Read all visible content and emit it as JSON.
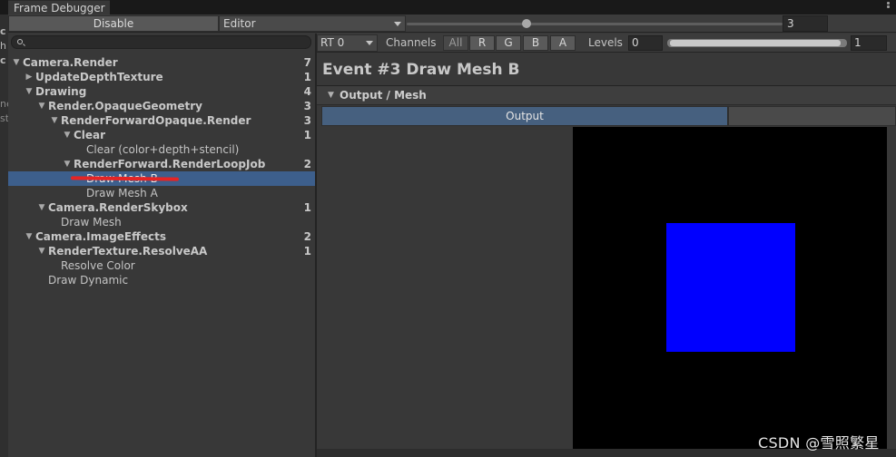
{
  "window": {
    "tab_title": "Frame Debugger"
  },
  "ghost_strip": [
    "c",
    "h",
    "c",
    "ne",
    "st"
  ],
  "toolbar": {
    "disable_label": "Disable",
    "target_dropdown": "Editor",
    "event_slider": {
      "value": 3,
      "max": 7,
      "fraction": 0.32
    },
    "event_index": "3"
  },
  "tree": {
    "search_placeholder": "",
    "items": [
      {
        "label": "Camera.Render",
        "count": "7",
        "depth": 0,
        "expand": "open",
        "bold": true
      },
      {
        "label": "UpdateDepthTexture",
        "count": "1",
        "depth": 1,
        "expand": "closed",
        "bold": true
      },
      {
        "label": "Drawing",
        "count": "4",
        "depth": 1,
        "expand": "open",
        "bold": true
      },
      {
        "label": "Render.OpaqueGeometry",
        "count": "3",
        "depth": 2,
        "expand": "open",
        "bold": true
      },
      {
        "label": "RenderForwardOpaque.Render",
        "count": "3",
        "depth": 3,
        "expand": "open",
        "bold": true
      },
      {
        "label": "Clear",
        "count": "1",
        "depth": 4,
        "expand": "open",
        "bold": true
      },
      {
        "label": "Clear (color+depth+stencil)",
        "count": "",
        "depth": 5,
        "expand": "none",
        "bold": false
      },
      {
        "label": "RenderForward.RenderLoopJob",
        "count": "2",
        "depth": 4,
        "expand": "open",
        "bold": true
      },
      {
        "label": "Draw Mesh B",
        "count": "",
        "depth": 5,
        "expand": "none",
        "bold": false,
        "selected": true
      },
      {
        "label": "Draw Mesh A",
        "count": "",
        "depth": 5,
        "expand": "none",
        "bold": false
      },
      {
        "label": "Camera.RenderSkybox",
        "count": "1",
        "depth": 2,
        "expand": "open",
        "bold": true
      },
      {
        "label": "Draw Mesh",
        "count": "",
        "depth": 3,
        "expand": "none",
        "bold": false
      },
      {
        "label": "Camera.ImageEffects",
        "count": "2",
        "depth": 1,
        "expand": "open",
        "bold": true
      },
      {
        "label": "RenderTexture.ResolveAA",
        "count": "1",
        "depth": 2,
        "expand": "open",
        "bold": true
      },
      {
        "label": "Resolve Color",
        "count": "",
        "depth": 3,
        "expand": "none",
        "bold": false
      },
      {
        "label": "Draw Dynamic",
        "count": "",
        "depth": 2,
        "expand": "none",
        "bold": false
      }
    ]
  },
  "render_toolbar": {
    "rt_dropdown": "RT 0",
    "channels_label": "Channels",
    "channels": [
      "All",
      "R",
      "G",
      "B",
      "A"
    ],
    "levels_label": "Levels",
    "levels_min": "0",
    "levels_max": "1"
  },
  "details": {
    "event_title": "Event #3 Draw Mesh B",
    "section_title": "Output / Mesh",
    "output_tab": "Output"
  },
  "preview": {
    "background": "#000000",
    "mesh_color": "#0000ff"
  },
  "watermark": "CSDN @雪照繁星",
  "colors": {
    "selection": "#3d5f8c",
    "annotation_red": "#e52424",
    "tab_active": "#46607f"
  }
}
